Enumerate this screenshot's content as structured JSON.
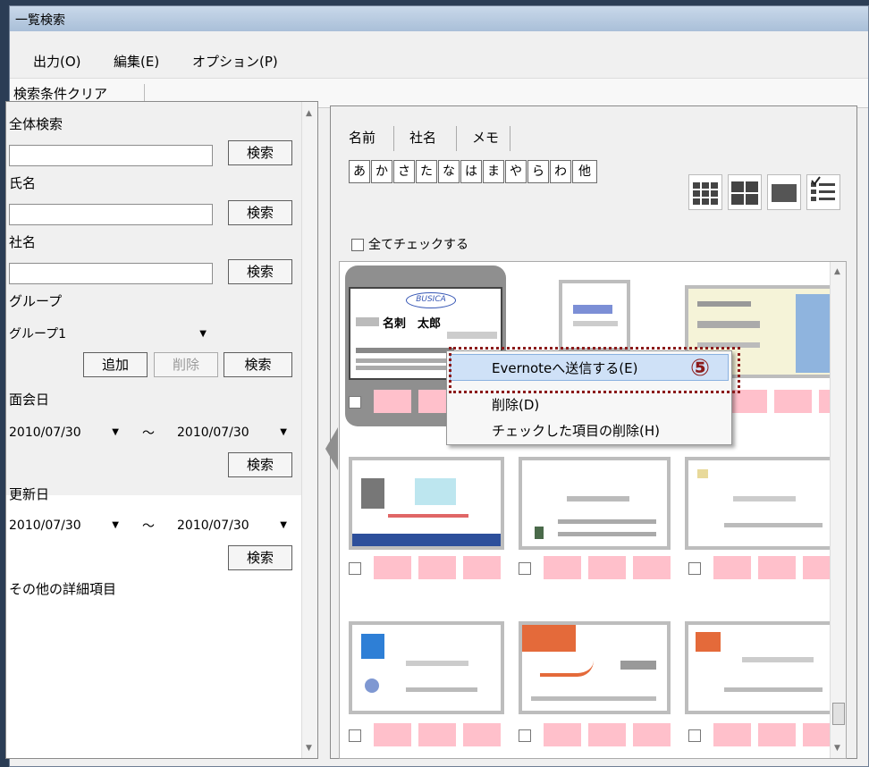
{
  "window": {
    "title": "一覧検索"
  },
  "menu": [
    "出力(O)",
    "編集(E)",
    "オプション(P)"
  ],
  "toolbar": {
    "clear_label": "検索条件クリア"
  },
  "left": {
    "all_search_label": "全体検索",
    "name_label": "氏名",
    "company_label": "社名",
    "group_label": "グループ",
    "group_value": "グループ1",
    "search_button": "検索",
    "add_button": "追加",
    "delete_button": "削除",
    "meet_date_label": "面会日",
    "update_date_label": "更新日",
    "date_from": "2010/07/30",
    "date_to": "2010/07/30",
    "tilde": "～",
    "other_label": "その他の詳細項目"
  },
  "right": {
    "tabs": [
      "名前",
      "社名",
      "メモ"
    ],
    "kana": [
      "あ",
      "か",
      "さ",
      "た",
      "な",
      "は",
      "ま",
      "や",
      "ら",
      "わ",
      "他"
    ],
    "check_all_label": "全てチェックする"
  },
  "card1": {
    "name_label": "名刺　太郎",
    "logo": "BUSICA"
  },
  "context_menu": {
    "items": [
      "Evernoteへ送信する(E)",
      "削除(D)",
      "チェックした項目の削除(H)"
    ],
    "step_badge": "⑤"
  },
  "colors": {
    "tag": "#ffc0cb",
    "highlight_border": "#8b1a1a",
    "menu_highlight": "#cfe1f7"
  },
  "icons": [
    "checkbox-icon",
    "dropdown-arrow-icon",
    "grid-small-icon",
    "grid-large-icon",
    "card-view-icon",
    "list-view-icon"
  ]
}
